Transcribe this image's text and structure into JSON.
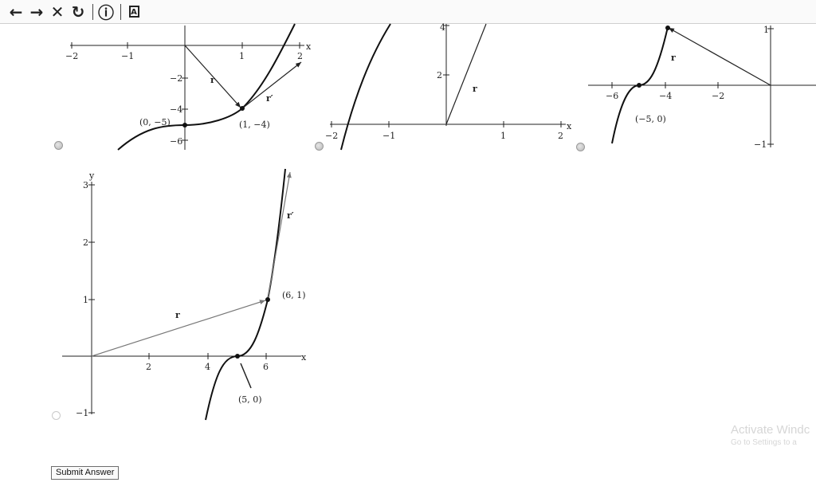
{
  "toolbar": {
    "items": [
      {
        "name": "back-icon",
        "glyph": "←"
      },
      {
        "name": "forward-icon",
        "glyph": "→"
      },
      {
        "name": "close-icon",
        "glyph": "✕"
      },
      {
        "name": "reload-icon",
        "glyph": "↻"
      },
      {
        "name": "info-icon",
        "glyph": "ⓘ"
      },
      {
        "name": "reader-icon",
        "glyph": "A"
      }
    ]
  },
  "graphs": {
    "g1": {
      "ticks_x": [
        "−2",
        "−1",
        "1",
        "2"
      ],
      "ticks_y": [
        "−2",
        "−4",
        "−6"
      ],
      "x_label": "x",
      "r": "r",
      "r_prime": "r′",
      "point_a": "(0, −5)",
      "point_b": "(1, −4)"
    },
    "g2": {
      "ticks_x": [
        "−2",
        "−1",
        "1",
        "2"
      ],
      "ticks_y": [
        "2",
        "4"
      ],
      "x_label": "x",
      "r": "r"
    },
    "g3": {
      "ticks_x": [
        "−6",
        "−4",
        "−2"
      ],
      "ticks_y": [
        "1",
        "−1"
      ],
      "r": "r",
      "point": "(−5, 0)"
    },
    "g4": {
      "ticks_x": [
        "2",
        "4",
        "6"
      ],
      "ticks_y": [
        "1",
        "2",
        "3",
        "−1"
      ],
      "x_label": "x",
      "y_label": "y",
      "r": "r",
      "r_prime": "r′",
      "point_a": "(6, 1)",
      "point_b": "(5, 0)"
    }
  },
  "submit_label": "Submit Answer",
  "watermark": {
    "line1": "Activate Windc",
    "line2": "Go to Settings to a"
  }
}
